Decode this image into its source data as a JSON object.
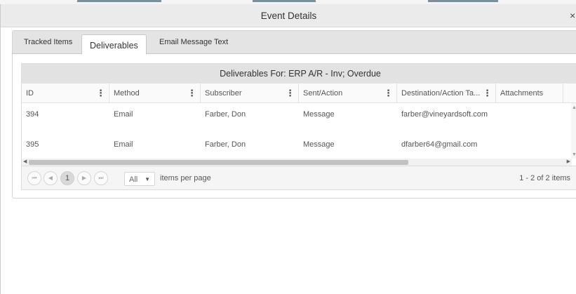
{
  "dialog": {
    "title": "Event Details",
    "close_glyph": "×"
  },
  "tabs": [
    {
      "label": "Tracked Items",
      "active": false
    },
    {
      "label": "Deliverables",
      "active": true
    },
    {
      "label": "Email Message Text",
      "active": false
    }
  ],
  "grid": {
    "caption": "Deliverables For: ERP A/R - Inv; Overdue",
    "columns": [
      "ID",
      "Method",
      "Subscriber",
      "Sent/Action",
      "Destination/Action Ta...",
      "Attachments"
    ],
    "column_menu_glyph": "⋮",
    "rows": [
      {
        "id": "394",
        "method": "Email",
        "subscriber": "Farber, Don",
        "sent_action": "Message",
        "destination": "farber@vineyardsoft.com",
        "attachments": ""
      },
      {
        "id": "395",
        "method": "Email",
        "subscriber": "Farber, Don",
        "sent_action": "Message",
        "destination": "dfarber64@gmail.com",
        "attachments": ""
      }
    ]
  },
  "pager": {
    "first_glyph": "⏮",
    "prev_glyph": "◀",
    "current_page": "1",
    "next_glyph": "▶",
    "last_glyph": "⏭",
    "page_size_value": "All",
    "dropdown_glyph": "▼",
    "items_per_page_label": "items per page",
    "info": "1 - 2 of 2 items"
  },
  "scrollbar_glyphs": {
    "up": "▲",
    "down": "▼",
    "left": "◀",
    "right": "▶"
  },
  "colors": {
    "titlebar_bg": "#ebebeb",
    "tabstrip_bg": "#e4e4e4",
    "caption_bg": "#e2e2e2",
    "scroll_thumb": "#c1c1c1"
  }
}
